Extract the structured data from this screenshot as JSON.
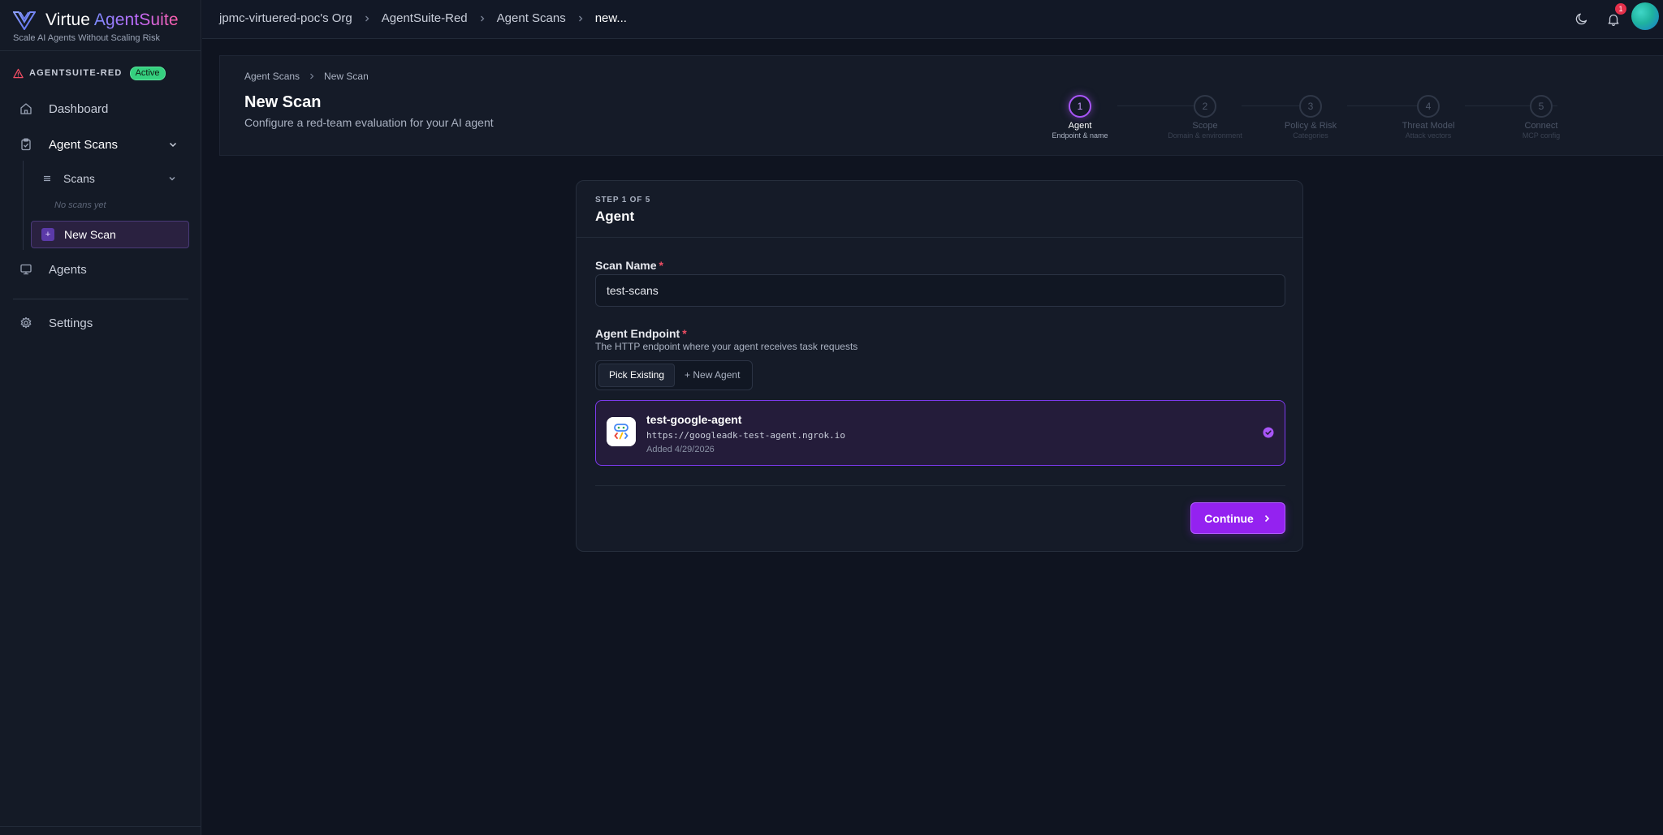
{
  "brand": {
    "name_prefix": "Virtue ",
    "name_accent": "AgentSuite",
    "tagline": "Scale AI Agents Without Scaling Risk"
  },
  "workspace": {
    "name": "AGENTSUITE-RED",
    "status": "Active"
  },
  "sidebar": {
    "dashboard": "Dashboard",
    "agent_scans": "Agent Scans",
    "scans": "Scans",
    "no_scans": "No scans yet",
    "new_scan": "New Scan",
    "new_scan_plus": "+",
    "agents": "Agents",
    "settings": "Settings"
  },
  "topbar": {
    "breadcrumbs": [
      "jpmc-virtuered-poc's Org",
      "AgentSuite-Red",
      "Agent Scans",
      "new..."
    ],
    "notification_count": "1"
  },
  "page": {
    "breadcrumbs": [
      "Agent Scans",
      "New Scan"
    ],
    "title": "New Scan",
    "subtitle": "Configure a red-team evaluation for your AI agent"
  },
  "steps": [
    {
      "number": "1",
      "label": "Agent",
      "desc": "Endpoint & name",
      "active": true
    },
    {
      "number": "2",
      "label": "Scope",
      "desc": "Domain & environment",
      "active": false
    },
    {
      "number": "3",
      "label": "Policy & Risk",
      "desc": "Categories",
      "active": false
    },
    {
      "number": "4",
      "label": "Threat Model",
      "desc": "Attack vectors",
      "active": false
    },
    {
      "number": "5",
      "label": "Connect",
      "desc": "MCP config",
      "active": false
    }
  ],
  "form": {
    "step_of": "STEP 1 OF 5",
    "title": "Agent",
    "scan_name_label": "Scan Name",
    "scan_name_value": "test-scans",
    "required_mark": "*",
    "endpoint_label": "Agent Endpoint",
    "endpoint_help": "The HTTP endpoint where your agent receives task requests",
    "tab_pick": "Pick Existing",
    "tab_new": "+ New Agent",
    "agent": {
      "name": "test-google-agent",
      "url": "https://googleadk-test-agent.ngrok.io",
      "added": "Added 4/29/2026"
    },
    "continue_label": "Continue"
  },
  "colors": {
    "accent": "#9422f0",
    "active_badge": "#35d07f",
    "required": "#ef4d63"
  }
}
